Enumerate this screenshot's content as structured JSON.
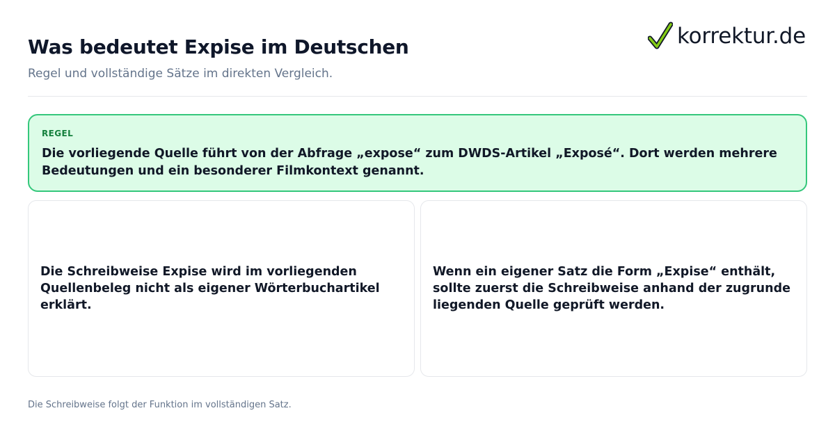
{
  "header": {
    "title": "Was bedeutet Expise im Deutschen",
    "subtitle": "Regel und vollständige Sätze im direkten Vergleich."
  },
  "logo": {
    "text": "korrektur.de",
    "icon": "checkmark-icon",
    "accent_color": "#84cc16"
  },
  "rule": {
    "label": "REGEL",
    "text": "Die vorliegende Quelle führt von der Abfrage „expose“ zum DWDS-Artikel „Exposé“. Dort werden mehrere Bedeutungen und ein besonderer Filmkontext genannt.",
    "border_color": "#34c77b",
    "background_color": "#dcfce7"
  },
  "cards": [
    {
      "text": "Die Schreibweise Expise wird im vorliegenden Quellenbeleg nicht als eigener Wörterbuchartikel erklärt."
    },
    {
      "text": "Wenn ein eigener Satz die Form „Expise“ enthält, sollte zuerst die Schreibweise anhand der zugrunde liegenden Quelle geprüft werden."
    }
  ],
  "footer": {
    "text": "Die Schreibweise folgt der Funktion im vollständigen Satz."
  }
}
